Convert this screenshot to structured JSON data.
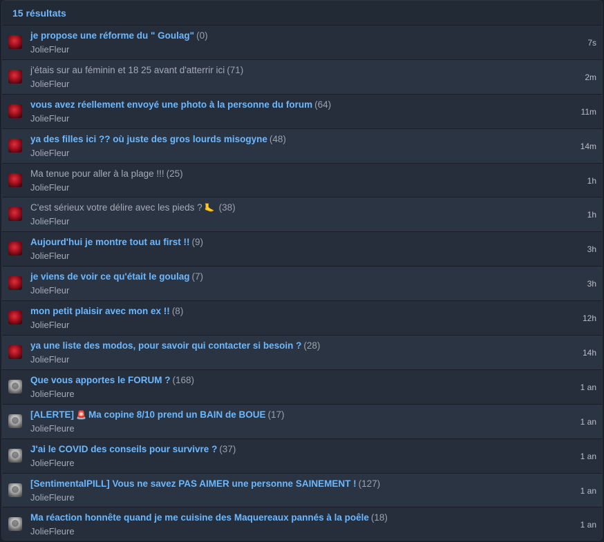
{
  "header": {
    "count_label": "15 résultats"
  },
  "topics": [
    {
      "title": "je propose une réforme du \" Goulag\"",
      "replies": "(0)",
      "author": "JolieFleur",
      "time": "7s",
      "avatar": "rose-avatar",
      "visited": false
    },
    {
      "title": "j'étais sur au féminin et 18 25 avant d'atterrir ici",
      "replies": "(71)",
      "author": "JolieFleur",
      "time": "2m",
      "avatar": "rose-avatar",
      "visited": true
    },
    {
      "title": "vous avez réellement envoyé une photo à la personne du forum",
      "replies": "(64)",
      "author": "JolieFleur",
      "time": "11m",
      "avatar": "rose-avatar",
      "visited": false
    },
    {
      "title": "ya des filles ici ?? où juste des gros lourds misogyne",
      "replies": "(48)",
      "author": "JolieFleur",
      "time": "14m",
      "avatar": "rose-avatar",
      "visited": false
    },
    {
      "title": "Ma tenue pour aller à la plage !!!",
      "replies": "(25)",
      "author": "JolieFleur",
      "time": "1h",
      "avatar": "rose-avatar",
      "visited": true
    },
    {
      "title": "C'est sérieux votre délire avec les pieds ?",
      "emoji": "🦶",
      "emoji_name": "foot-emoji-icon",
      "replies": "(38)",
      "author": "JolieFleur",
      "time": "1h",
      "avatar": "rose-avatar",
      "visited": true
    },
    {
      "title": "Aujourd'hui je montre tout au first !!",
      "replies": "(9)",
      "author": "JolieFleur",
      "time": "3h",
      "avatar": "rose-avatar",
      "visited": false
    },
    {
      "title": "je viens de voir ce qu'était le goulag",
      "replies": "(7)",
      "author": "JolieFleur",
      "time": "3h",
      "avatar": "rose-avatar",
      "visited": false
    },
    {
      "title": "mon petit plaisir avec mon ex !!",
      "replies": "(8)",
      "author": "JolieFleur",
      "time": "12h",
      "avatar": "rose-avatar",
      "visited": false
    },
    {
      "title": "ya une liste des modos, pour savoir qui contacter si besoin ?",
      "replies": "(28)",
      "author": "JolieFleur",
      "time": "14h",
      "avatar": "rose-avatar",
      "visited": false
    },
    {
      "title": "Que vous apportes le FORUM ?",
      "replies": "(168)",
      "author": "JolieFleure",
      "time": "1 an",
      "avatar": "gray-avatar",
      "visited": false
    },
    {
      "title_prefix": "[ALERTE]",
      "emoji": "🚨",
      "emoji_name": "siren-emoji-icon",
      "title": "Ma copine 8/10 prend un BAIN de BOUE",
      "replies": "(17)",
      "author": "JolieFleure",
      "time": "1 an",
      "avatar": "gray-avatar",
      "visited": false
    },
    {
      "title": "J'ai le COVID des conseils pour survivre ?",
      "replies": "(37)",
      "author": "JolieFleure",
      "time": "1 an",
      "avatar": "gray-avatar",
      "visited": false
    },
    {
      "title": "[SentimentalPILL] Vous ne savez PAS AIMER une personne SAINEMENT !",
      "replies": "(127)",
      "author": "JolieFleure",
      "time": "1 an",
      "avatar": "gray-avatar",
      "visited": false
    },
    {
      "title": "Ma réaction honnête quand je me cuisine des Maquereaux pannés à la poêle",
      "replies": "(18)",
      "author": "JolieFleure",
      "time": "1 an",
      "avatar": "gray-avatar",
      "visited": false
    }
  ]
}
